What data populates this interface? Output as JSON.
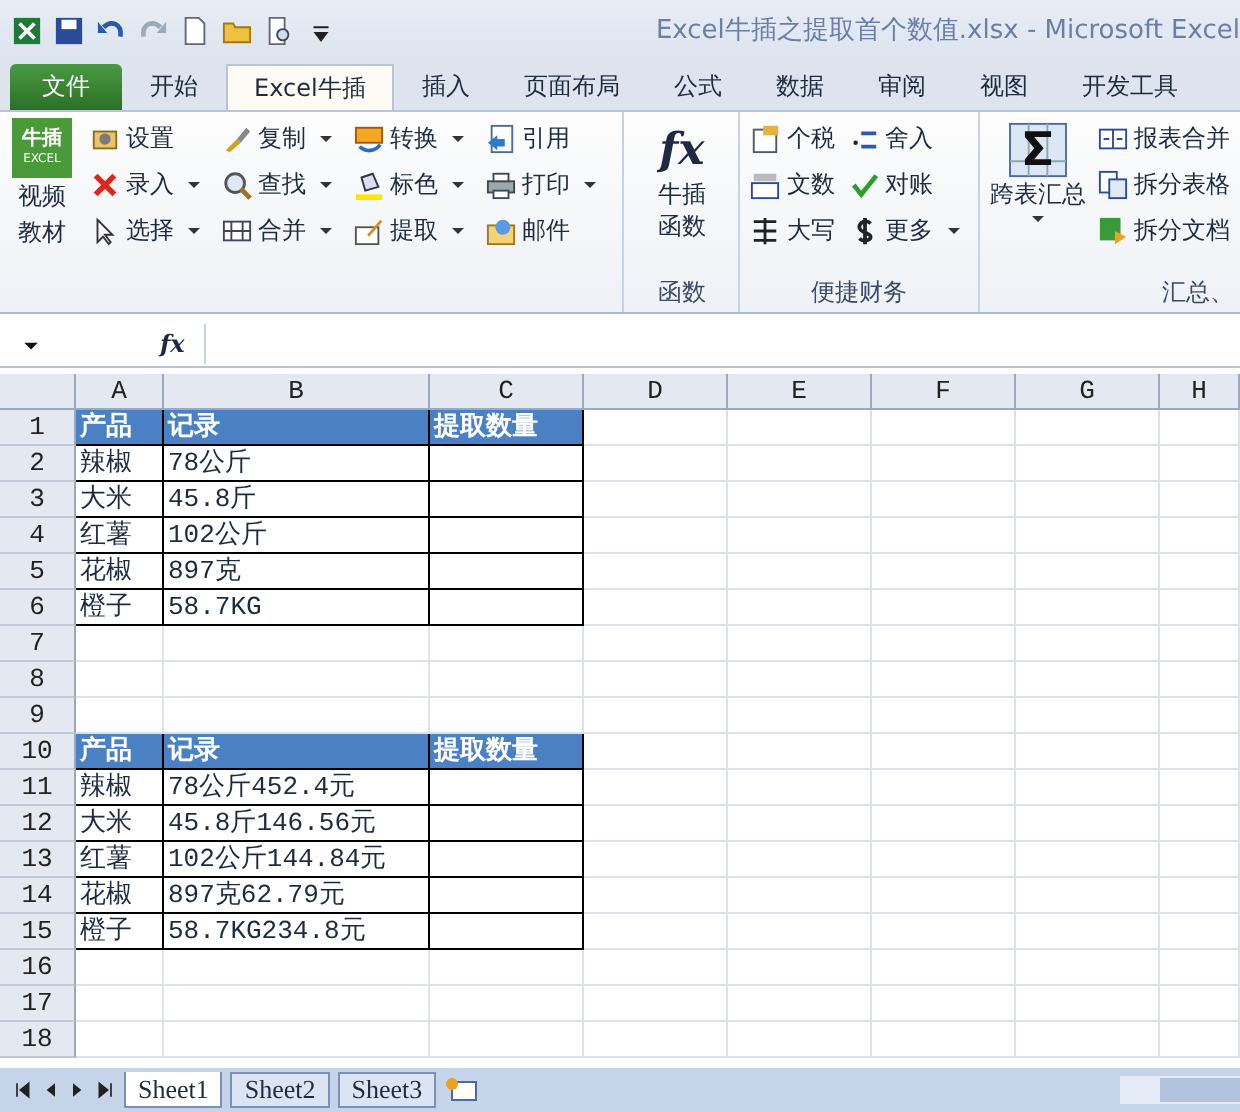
{
  "window": {
    "title": "Excel牛插之提取首个数值.xlsx  -  Microsoft Excel"
  },
  "tabs": [
    {
      "label": "文件",
      "kind": "file",
      "selected": false
    },
    {
      "label": "开始",
      "kind": "tab",
      "selected": false
    },
    {
      "label": "Excel牛插",
      "kind": "tab",
      "selected": true
    },
    {
      "label": "插入",
      "kind": "tab",
      "selected": false
    },
    {
      "label": "页面布局",
      "kind": "tab",
      "selected": false
    },
    {
      "label": "公式",
      "kind": "tab",
      "selected": false
    },
    {
      "label": "数据",
      "kind": "tab",
      "selected": false
    },
    {
      "label": "审阅",
      "kind": "tab",
      "selected": false
    },
    {
      "label": "视图",
      "kind": "tab",
      "selected": false
    },
    {
      "label": "开发工具",
      "kind": "tab",
      "selected": false
    }
  ],
  "ribbon": {
    "logo": {
      "top": "牛插",
      "bottom": "EXCEL",
      "caption": "视频教材"
    },
    "tool_columns": [
      [
        {
          "label": "设置",
          "has_menu": false
        },
        {
          "label": "录入",
          "has_menu": true
        },
        {
          "label": "选择",
          "has_menu": true
        }
      ],
      [
        {
          "label": "复制",
          "has_menu": true
        },
        {
          "label": "查找",
          "has_menu": true
        },
        {
          "label": "合并",
          "has_menu": true
        }
      ],
      [
        {
          "label": "转换",
          "has_menu": true
        },
        {
          "label": "标色",
          "has_menu": true
        },
        {
          "label": "提取",
          "has_menu": true
        }
      ],
      [
        {
          "label": "引用",
          "has_menu": false
        },
        {
          "label": "打印",
          "has_menu": true
        },
        {
          "label": "邮件",
          "has_menu": false
        }
      ]
    ],
    "function_group": {
      "glyph": "fx",
      "caption": "牛插函数",
      "label": "函数"
    },
    "finance_group": {
      "label": "便捷财务",
      "items": [
        {
          "label": "个税",
          "has_menu": false
        },
        {
          "label": "舍入",
          "has_menu": false
        },
        {
          "label": "文数",
          "has_menu": false
        },
        {
          "label": "对账",
          "has_menu": false
        },
        {
          "label": "大写",
          "has_menu": false
        },
        {
          "label": "更多",
          "has_menu": true
        }
      ]
    },
    "summary_group": {
      "label": "汇总、",
      "big": {
        "label": "跨表汇总",
        "has_menu": true
      },
      "items": [
        {
          "label": "报表合并"
        },
        {
          "label": "拆分表格"
        },
        {
          "label": "拆分文档"
        }
      ]
    }
  },
  "formula_bar": {
    "fx": "fx"
  },
  "sheet": {
    "columns": [
      "A",
      "B",
      "C",
      "D",
      "E",
      "F",
      "G",
      "H"
    ],
    "rows": [
      {
        "number": "1",
        "kind": "header",
        "cells": [
          "产品",
          "记录",
          "提取数量"
        ]
      },
      {
        "number": "2",
        "kind": "data",
        "cells": [
          "辣椒",
          "78公斤",
          ""
        ]
      },
      {
        "number": "3",
        "kind": "data",
        "cells": [
          "大米",
          "45.8斤",
          ""
        ]
      },
      {
        "number": "4",
        "kind": "data",
        "cells": [
          "红薯",
          "102公斤",
          ""
        ]
      },
      {
        "number": "5",
        "kind": "data",
        "cells": [
          "花椒",
          "897克",
          ""
        ]
      },
      {
        "number": "6",
        "kind": "data",
        "cells": [
          "橙子",
          "58.7KG",
          ""
        ]
      },
      {
        "number": "7",
        "kind": "empty",
        "cells": []
      },
      {
        "number": "8",
        "kind": "empty",
        "cells": []
      },
      {
        "number": "9",
        "kind": "empty",
        "cells": []
      },
      {
        "number": "10",
        "kind": "header",
        "cells": [
          "产品",
          "记录",
          "提取数量"
        ]
      },
      {
        "number": "11",
        "kind": "data",
        "cells": [
          "辣椒",
          "78公斤452.4元",
          ""
        ]
      },
      {
        "number": "12",
        "kind": "data",
        "cells": [
          "大米",
          "45.8斤146.56元",
          ""
        ]
      },
      {
        "number": "13",
        "kind": "data",
        "cells": [
          "红薯",
          "102公斤144.84元",
          ""
        ]
      },
      {
        "number": "14",
        "kind": "data",
        "cells": [
          "花椒",
          "897克62.79元",
          ""
        ]
      },
      {
        "number": "15",
        "kind": "data",
        "cells": [
          "橙子",
          "58.7KG234.8元",
          ""
        ]
      },
      {
        "number": "16",
        "kind": "empty",
        "cells": []
      },
      {
        "number": "17",
        "kind": "empty",
        "cells": []
      },
      {
        "number": "18",
        "kind": "empty",
        "cells": []
      }
    ]
  },
  "sheet_tabs": [
    {
      "label": "Sheet1",
      "selected": true
    },
    {
      "label": "Sheet2",
      "selected": false
    },
    {
      "label": "Sheet3",
      "selected": false
    }
  ]
}
